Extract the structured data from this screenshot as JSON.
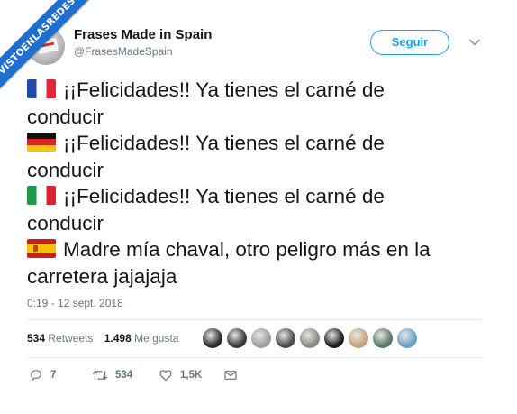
{
  "watermark": {
    "text": "VISTOENLASREDES",
    "color": "#1f6fd1"
  },
  "tweet": {
    "author": {
      "display_name": "Frases Made in Spain",
      "handle": "@FrasesMadeSpain"
    },
    "follow_label": "Seguir",
    "lines": [
      {
        "flag": "flag-france",
        "text": "¡¡Felicidades!! Ya tienes el carné de",
        "cont": "conducir"
      },
      {
        "flag": "flag-germany",
        "text": "¡¡Felicidades!! Ya tienes el carné de",
        "cont": "conducir"
      },
      {
        "flag": "flag-italy",
        "text": "¡¡Felicidades!! Ya tienes el carné de",
        "cont": "conducir"
      },
      {
        "flag": "flag-spain",
        "text": "Madre mía chaval, otro peligro más en la",
        "cont": "carretera jajajaja"
      }
    ],
    "timestamp": "0:19 - 12 sept. 2018",
    "stats": {
      "retweets_count": "534",
      "retweets_label": "Retweets",
      "likes_count": "1.498",
      "likes_label": "Me gusta"
    },
    "likers": [
      "#2b2b2b",
      "#3a3a3a",
      "#9e9e9e",
      "#4a4a4a",
      "#8c8a86",
      "#1e1e1e",
      "#c9a27a",
      "#5c7a6a",
      "#6aa0c6"
    ],
    "actions": {
      "replies": "7",
      "retweets": "534",
      "likes": "1,5K"
    },
    "colors": {
      "accent": "#1da1f2",
      "muted": "#657786",
      "text": "#14171a"
    }
  }
}
